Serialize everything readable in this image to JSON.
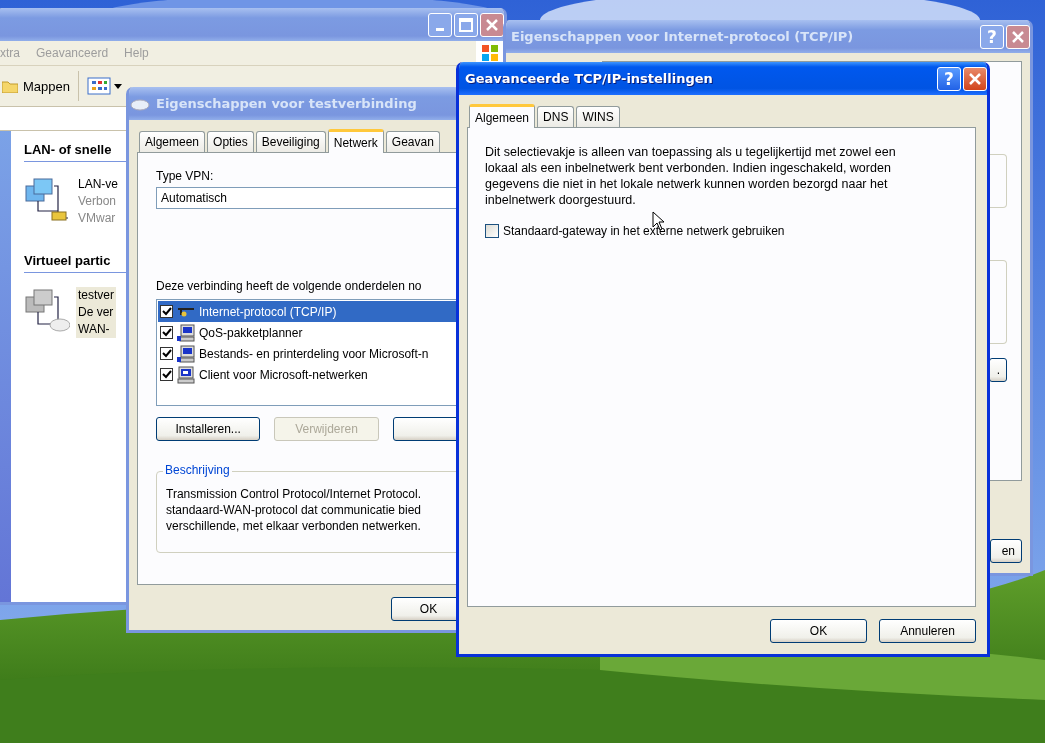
{
  "explorer": {
    "menu": [
      "xtra",
      "Geavanceerd",
      "Help"
    ],
    "toolbar": {
      "folders": "Mappen"
    },
    "groups": [
      {
        "title": "LAN- of snelle",
        "items": [
          {
            "kind": "lan",
            "selected": false,
            "lines": [
              "LAN-ve",
              "Verbon",
              "VMwar"
            ]
          }
        ]
      },
      {
        "title": "Virtueel partic",
        "items": [
          {
            "kind": "vpn",
            "selected": true,
            "lines": [
              "testver",
              "De ver",
              "WAN-"
            ]
          }
        ]
      }
    ]
  },
  "tcpip_dialog": {
    "title": "Eigenschappen voor Internet-protocol (TCP/IP)",
    "help": "?",
    "buttons": [
      ".",
      "en"
    ]
  },
  "connection_dialog": {
    "title": "Eigenschappen voor testverbinding",
    "tabs": [
      {
        "label": "Algemeen",
        "selected": false
      },
      {
        "label": "Opties",
        "selected": false
      },
      {
        "label": "Beveiliging",
        "selected": false
      },
      {
        "label": "Netwerk",
        "selected": true
      },
      {
        "label": "Geavan",
        "selected": false
      }
    ],
    "vpn_type_label": "Type VPN:",
    "vpn_type_value": "Automatisch",
    "components_label": "Deze verbinding heeft de volgende onderdelen no",
    "components": [
      {
        "label": "Internet-protocol (TCP/IP)",
        "kind": "protocol",
        "checked": true,
        "selected": true
      },
      {
        "label": "QoS-pakketplanner",
        "kind": "service",
        "checked": true,
        "selected": false
      },
      {
        "label": "Bestands- en printerdeling voor Microsoft-n",
        "kind": "service",
        "checked": true,
        "selected": false
      },
      {
        "label": "Client voor Microsoft-netwerken",
        "kind": "client",
        "checked": true,
        "selected": false
      }
    ],
    "buttons": [
      {
        "label": "Installeren...",
        "disabled": false
      },
      {
        "label": "Verwijderen",
        "disabled": true
      }
    ],
    "description": {
      "title": "Beschrijving",
      "lines": [
        "Transmission Control Protocol/Internet Protocol.",
        "standaard-WAN-protocol dat communicatie bied",
        "verschillende, met elkaar verbonden netwerken."
      ]
    },
    "ok": "OK"
  },
  "advanced_dialog": {
    "title": "Geavanceerde TCP/IP-instellingen",
    "help": "?",
    "tabs": [
      {
        "label": "Algemeen",
        "selected": true
      },
      {
        "label": "DNS",
        "selected": false
      },
      {
        "label": "WINS",
        "selected": false
      }
    ],
    "info": "Dit selectievakje is alleen van toepassing als u tegelijkertijd met zowel een lokaal als een inbelnetwerk bent verbonden. Indien ingeschakeld, worden gegevens die niet in het lokale netwerk kunnen worden bezorgd naar het inbelnetwerk doorgestuurd.",
    "gateway": {
      "label": "Standaard-gateway in het externe netwerk gebruiken",
      "checked": false
    },
    "buttons": [
      "OK",
      "Annuleren"
    ]
  }
}
